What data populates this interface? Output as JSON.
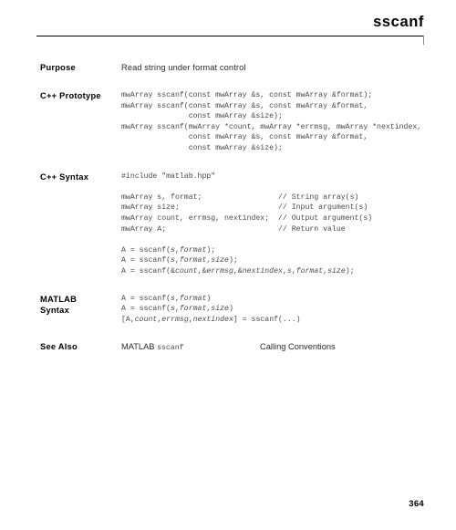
{
  "header": {
    "title": "sscanf"
  },
  "footer": {
    "page_number": "364"
  },
  "sections": {
    "purpose": {
      "label": "Purpose",
      "text": "Read string under format control"
    },
    "cpp_prototype": {
      "label": "C++ Prototype",
      "code": "mwArray sscanf(const mwArray &s, const mwArray &format);\nmwArray sscanf(const mwArray &s, const mwArray &format,\n               const mwArray &size);\nmwArray sscanf(mwArray *count, mwArray *errmsg, mwArray *nextindex,\n               const mwArray &s, const mwArray &format,\n               const mwArray &size);"
    },
    "cpp_syntax": {
      "label": "C++ Syntax",
      "include_line": "#include \"matlab.hpp\"",
      "declarations": "mwArray s, format;                 // String array(s)\nmwArray size;                      // Input argument(s)\nmwArray count, errmsg, nextindex;  // Output argument(s)\nmwArray A;                         // Return value",
      "calls": "A = sscanf(s,format);\nA = sscanf(s,format,size);\nA = sscanf(&count,&errmsg,&nextindex,s,format,size);"
    },
    "matlab_syntax": {
      "label": "MATLAB\nSyntax",
      "code": "A = sscanf(s,format)\nA = sscanf(s,format,size)\n[A,count,errmsg,nextindex] = sscanf(...)"
    },
    "see_also": {
      "label": "See Also",
      "item_a_prefix": "MATLAB ",
      "item_a_mono": "sscanf",
      "item_b": "Calling Conventions"
    }
  }
}
